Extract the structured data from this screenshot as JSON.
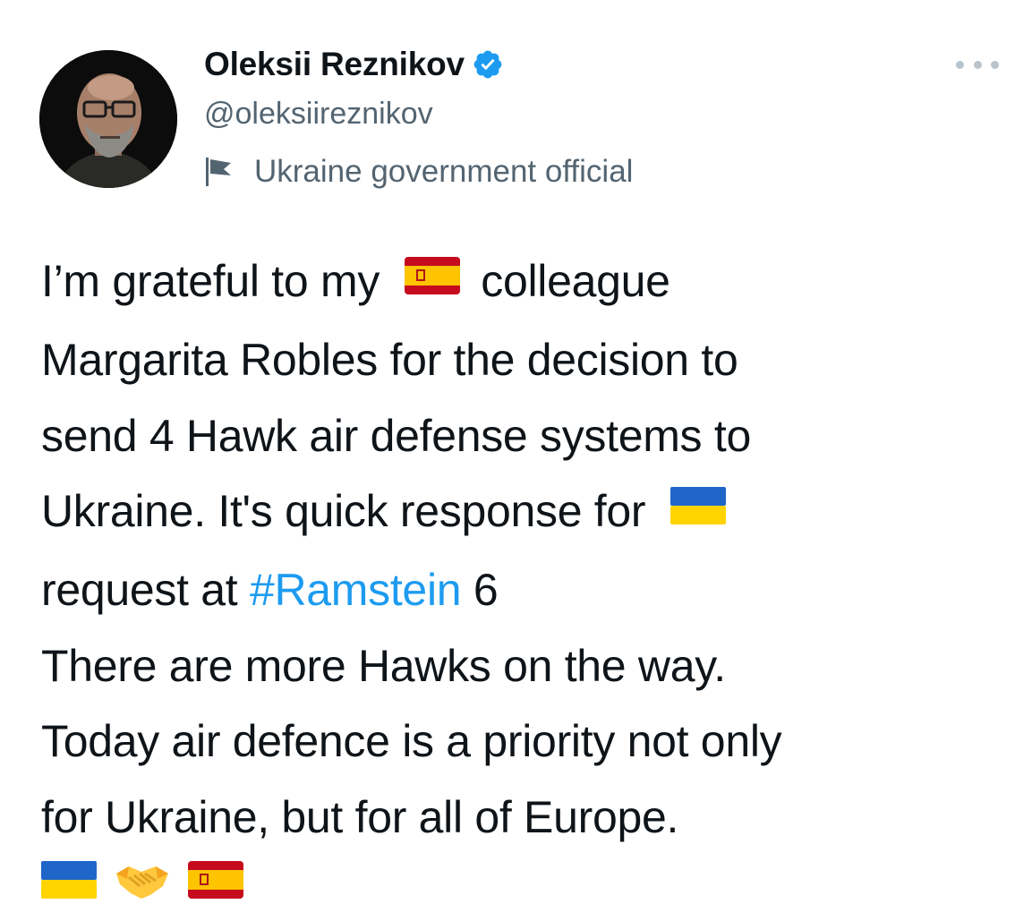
{
  "author": {
    "name": "Oleksii Reznikov",
    "handle": "@oleksiireznikov",
    "label": "Ukraine government official",
    "verified": true
  },
  "icons": {
    "verified": "verified-badge-icon",
    "label": "government-flag-icon",
    "more": "more-options-icon"
  },
  "tweet": {
    "l1_a": "I’m grateful to my",
    "l1_b": "colleague",
    "l2": "Margarita Robles for the decision to",
    "l3": "send 4 Hawk air defense systems to",
    "l4": "Ukraine. It's quick response for",
    "l5_a": "request at",
    "hashtag": "#Ramstein",
    "l5_b": "6",
    "l6": "There are more Hawks on the way.",
    "l7": "Today air defence is a priority not only",
    "l8": "for Ukraine, but for all of Europe.",
    "trailing_emojis": [
      "ukraine-flag",
      "handshake",
      "spain-flag"
    ]
  },
  "colors": {
    "text": "#0f1419",
    "secondary": "#536471",
    "link": "#1d9bf0",
    "verified": "#1d9bf0"
  }
}
